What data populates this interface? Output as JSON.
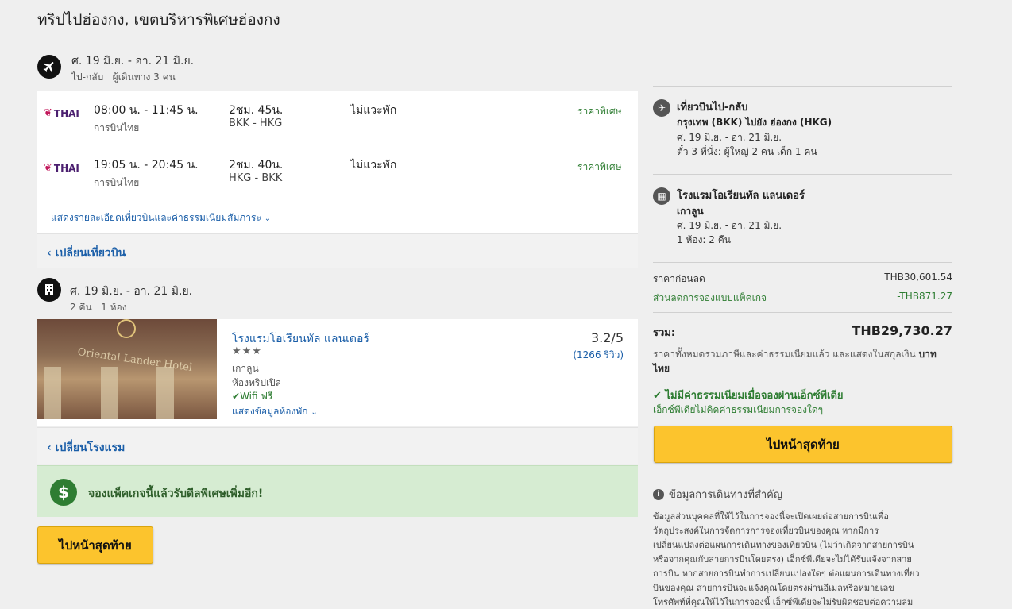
{
  "page": {
    "title": "ทริปไปฮ่องกง, เขตบริหารพิเศษฮ่องกง"
  },
  "flight_section": {
    "dates": "ศ. 19 มิ.ย. - อา. 21 มิ.ย.",
    "sub": "ไป-กลับ   ผู้เดินทาง 3 คน",
    "flights": [
      {
        "airline_logo": "THAI",
        "times": "08:00 น. - 11:45 น.",
        "airline": "การบินไทย",
        "duration": "2ชม. 45น.",
        "route": "BKK - HKG",
        "stops": "ไม่แวะพัก",
        "price_tag": "ราคาพิเศษ"
      },
      {
        "airline_logo": "THAI",
        "times": "19:05 น. - 20:45 น.",
        "airline": "การบินไทย",
        "duration": "2ชม. 40น.",
        "route": "HKG - BKK",
        "stops": "ไม่แวะพัก",
        "price_tag": "ราคาพิเศษ"
      }
    ],
    "details_link": "แสดงรายละเอียดเที่ยวบินและค่าธรรมเนียมสัมภาระ",
    "change_link": "เปลี่ยนเที่ยวบิน"
  },
  "hotel_section": {
    "dates": "ศ. 19 มิ.ย. - อา. 21 มิ.ย.",
    "sub": "2 คืน   1 ห้อง",
    "hotel": {
      "name": "โรงแรมโอเรียนทัล แลนเดอร์",
      "stars": "★★★",
      "area": "เกาลูน",
      "room": "ห้องทริปเปิล",
      "wifi": "Wifi ฟรี",
      "room_info_link": "แสดงข้อมูลห้องพัก",
      "rating": "3.2/5",
      "reviews": "(1266 รีวิว)",
      "image_sign": "Oriental Lander Hotel"
    },
    "change_link": "เปลี่ยนโรงแรม"
  },
  "promo": {
    "text": "จองแพ็คเกจนี้แล้วรับดีลพิเศษเพิ่มอีก!"
  },
  "bottom_button": "ไปหน้าสุดท้าย",
  "summary": {
    "flight": {
      "title": "เที่ยวบินไป-กลับ",
      "route": "กรุงเทพ (BKK) ไปยัง ฮ่องกง (HKG)",
      "dates": "ศ. 19 มิ.ย. - อา. 21 มิ.ย.",
      "tickets": "ตั๋ว 3 ที่นั่ง: ผู้ใหญ่ 2 คน เด็ก 1 คน"
    },
    "hotel": {
      "title": "โรงแรมโอเรียนทัล แลนเดอร์",
      "area": "เกาลูน",
      "dates": "ศ. 19 มิ.ย. - อา. 21 มิ.ย.",
      "rooms": "1 ห้อง: 2 คืน"
    },
    "price_before_label": "ราคาก่อนลด",
    "price_before": "THB30,601.54",
    "discount_label": "ส่วนลดการจองแบบแพ็คเกจ",
    "discount": "-THB871.27",
    "total_label": "รวม:",
    "total": "THB29,730.27",
    "tax_note_1": "ราคาทั้งหมดรวมภาษีและค่าธรรมเนียมแล้ว และแสดงในสกุลเงิน",
    "tax_note_currency_1": "บาท",
    "tax_note_currency_2": "ไทย",
    "no_fee_title": "ไม่มีค่าธรรมเนียมเมื่อจองผ่านเอ็กซ์พีเดีย",
    "no_fee_sub": "เอ็กซ์พีเดียไม่คิดค่าธรรมเนียมการจองใดๆ",
    "button": "ไปหน้าสุดท้าย",
    "info_title": "ข้อมูลการเดินทางที่สำคัญ",
    "info_lines": [
      "ข้อมูลส่วนบุคคลที่ให้ไว้ในการจองนี้จะเปิดเผยต่อสายการบินเพื่อ",
      "วัตถุประสงค์ในการจัดการการจองเที่ยวบินของคุณ หากมีการ",
      "เปลี่ยนแปลงต่อแผนการเดินทางของเที่ยวบิน (ไม่ว่าเกิดจากสายการบิน",
      "หรือจากคุณกับสายการบินโดยตรง) เอ็กซ์พีเดียจะไม่ได้รับแจ้งจากสาย",
      "การบิน หากสายการบินทำการเปลี่ยนแปลงใดๆ ต่อแผนการเดินทางเที่ยว",
      "บินของคุณ สายการบินจะแจ้งคุณโดยตรงผ่านอีเมลหรือหมายเลข",
      "โทรศัพท์ที่คุณให้ไว้ในการจองนี้ เอ็กซ์พีเดียจะไม่รับผิดชอบต่อความล่ม"
    ]
  }
}
